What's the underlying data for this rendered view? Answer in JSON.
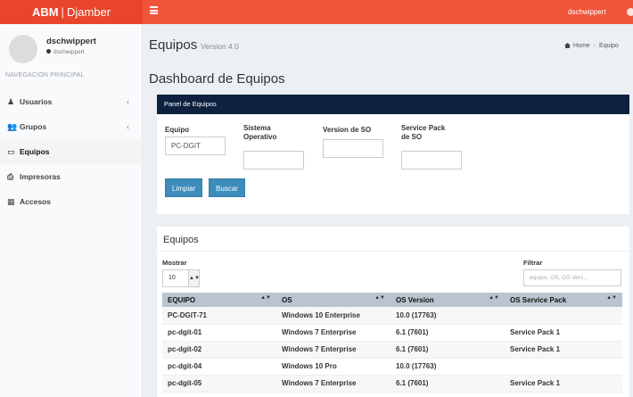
{
  "topbar": {
    "brand_bold": "ABM",
    "brand_sep": "|",
    "brand_rest": "Djamber",
    "user": "dschwippert"
  },
  "sidebar": {
    "user_name": "dschwippert",
    "user_status": "dschwippert",
    "nav_header": "NAVEGACION PRINCIPAL",
    "items": [
      {
        "label": "Usuarios",
        "icon": "user-icon",
        "glyph": "♟",
        "chevron": "‹"
      },
      {
        "label": "Grupos",
        "icon": "group-icon",
        "glyph": "👥",
        "chevron": "‹"
      },
      {
        "label": "Equipos",
        "icon": "desktop-icon",
        "glyph": "▭",
        "chevron": ""
      },
      {
        "label": "Impresoras",
        "icon": "printer-icon",
        "glyph": "⎙",
        "chevron": ""
      },
      {
        "label": "Accesos",
        "icon": "table-icon",
        "glyph": "▦",
        "chevron": ""
      }
    ]
  },
  "header": {
    "title": "Equipos",
    "version": "Version 4.0",
    "breadcrumb_home": "Home",
    "breadcrumb_current": "Equipo",
    "dashboard_title": "Dashboard de Equipos"
  },
  "search_panel": {
    "title": "Panel de Equipos",
    "fields": [
      {
        "label_1": "Equipo",
        "label_2": "",
        "value": "PC-DGIT"
      },
      {
        "label_1": "Sistema",
        "label_2": "Operativo",
        "value": ""
      },
      {
        "label_1": "Version de SO",
        "label_2": "",
        "value": ""
      },
      {
        "label_1": "Service Pack",
        "label_2": "de SO",
        "value": ""
      }
    ],
    "clear_label": "Limpiar",
    "search_label": "Buscar"
  },
  "results": {
    "title": "Equipos",
    "show_label": "Mostrar",
    "show_value": "10",
    "filter_label": "Filtrar",
    "filter_placeholder": "equipo, OS, OS Vers...",
    "columns": [
      "EQUIPO",
      "OS",
      "OS Version",
      "OS Service Pack"
    ],
    "rows": [
      [
        "PC-DGIT-71",
        "Windows 10 Enterprise",
        "10.0 (17763)",
        ""
      ],
      [
        "pc-dgit-01",
        "Windows 7 Enterprise",
        "6.1 (7601)",
        "Service Pack 1"
      ],
      [
        "pc-dgit-02",
        "Windows 7 Enterprise",
        "6.1 (7601)",
        "Service Pack 1"
      ],
      [
        "pc-dgit-04",
        "Windows 10 Pro",
        "10.0 (17763)",
        ""
      ],
      [
        "pc-dgit-05",
        "Windows 7 Enterprise",
        "6.1 (7601)",
        "Service Pack 1"
      ]
    ]
  },
  "colors": {
    "topbar": "#f0553c",
    "panel_header": "#0e2240",
    "button": "#3c8dbc",
    "table_header": "#b9c4d0"
  }
}
